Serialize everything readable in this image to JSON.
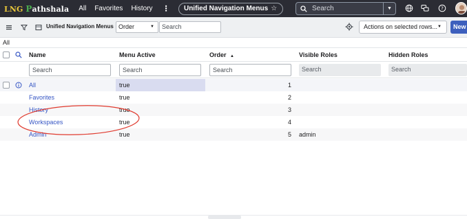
{
  "topnav": {
    "logo_prefix": "LNG",
    "logo_p": "P",
    "logo_rest": "athshala",
    "links": [
      "All",
      "Favorites",
      "History"
    ],
    "more": "⋮",
    "title": "Unified Navigation Menus",
    "star": "☆",
    "search_placeholder": "Search"
  },
  "toolbar": {
    "list_title": "Unified Navigation Menus",
    "field_select": "Order",
    "search_placeholder": "Search",
    "actions_label": "Actions on selected rows...",
    "new_label": "New"
  },
  "breadcrumb": "All",
  "table": {
    "headers": {
      "name": "Name",
      "menu_active": "Menu Active",
      "order": "Order",
      "sort_indicator": "▲",
      "visible_roles": "Visible Roles",
      "hidden_roles": "Hidden Roles"
    },
    "search_placeholder": "Search",
    "rows": [
      {
        "name": "All",
        "menu_active": "true",
        "order": "1",
        "visible_roles": "",
        "hidden_roles": ""
      },
      {
        "name": "Favorites",
        "menu_active": "true",
        "order": "2",
        "visible_roles": "",
        "hidden_roles": ""
      },
      {
        "name": "History",
        "menu_active": "true",
        "order": "3",
        "visible_roles": "",
        "hidden_roles": ""
      },
      {
        "name": "Workspaces",
        "menu_active": "true",
        "order": "4",
        "visible_roles": "",
        "hidden_roles": ""
      },
      {
        "name": "Admin",
        "menu_active": "true",
        "order": "5",
        "visible_roles": "admin",
        "hidden_roles": ""
      }
    ]
  },
  "colors": {
    "nav_bg": "#2b2c34",
    "link": "#3555c4",
    "new_button": "#3d5fbd",
    "highlight_row": "#d9dcf0",
    "annotation": "#e03a2e"
  }
}
